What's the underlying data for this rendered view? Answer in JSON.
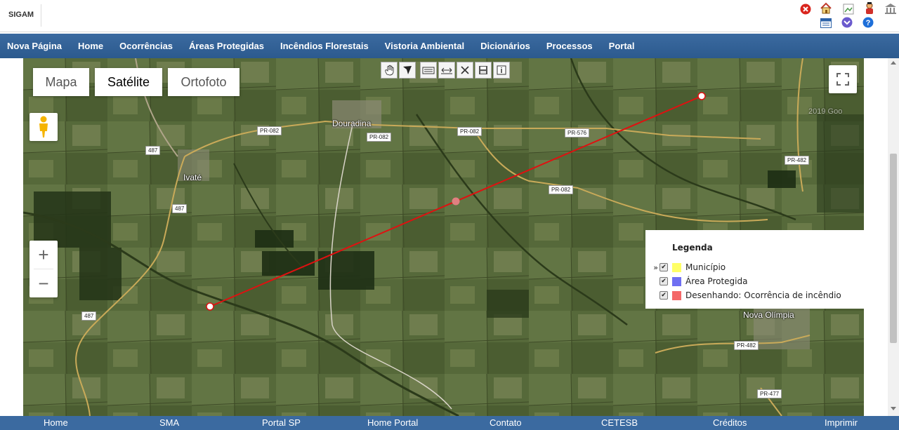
{
  "app": {
    "title": "SIGAM"
  },
  "header_icons": [
    {
      "name": "close-icon",
      "color": "#d9251d"
    },
    {
      "name": "home-icon"
    },
    {
      "name": "broken-image-icon"
    },
    {
      "name": "user-icon"
    },
    {
      "name": "bank-icon"
    },
    {
      "name": "calendar-icon"
    },
    {
      "name": "chevron-down-circle-icon",
      "color": "#6a5acd"
    },
    {
      "name": "help-icon",
      "color": "#1e6fd9"
    }
  ],
  "nav": {
    "items": [
      "Nova Página",
      "Home",
      "Ocorrências",
      "Áreas Protegidas",
      "Incêndios Florestais",
      "Vistoria Ambiental",
      "Dicionários",
      "Processos",
      "Portal"
    ]
  },
  "map": {
    "type_buttons": [
      "Mapa",
      "Satélite",
      "Ortofoto"
    ],
    "active_type": "Satélite",
    "zoom_in": "+",
    "zoom_out": "−",
    "draw_tools": [
      "hand-icon",
      "polygon-icon",
      "edit-area-icon",
      "measure-icon",
      "delete-icon",
      "save-icon",
      "info-icon"
    ],
    "places": [
      "Douradina",
      "Ivaté",
      "Nova Olímpia"
    ],
    "roads": [
      "PR-082",
      "PR-082",
      "PR-082",
      "PR-576",
      "PR-082",
      "PR-482",
      "PR-482",
      "PR-477",
      "487",
      "487",
      "487"
    ],
    "watermark": "2019 Goo"
  },
  "legend": {
    "title": "Legenda",
    "items": [
      {
        "label": "Município",
        "color": "#ffff66",
        "checked": true,
        "expander": "»"
      },
      {
        "label": "Área Protegida",
        "color": "#6f6ff2",
        "checked": true,
        "expander": ""
      },
      {
        "label": "Desenhando: Ocorrência de incêndio",
        "color": "#f46868",
        "checked": true,
        "expander": ""
      }
    ]
  },
  "footer": {
    "links": [
      "Home",
      "SMA",
      "Portal SP",
      "Home Portal",
      "Contato",
      "CETESB",
      "Créditos",
      "Imprimir"
    ]
  },
  "colors": {
    "nav_bg": "#2f5f93",
    "footer_bg": "#3b6aa0",
    "draw_line": "#e01010"
  }
}
